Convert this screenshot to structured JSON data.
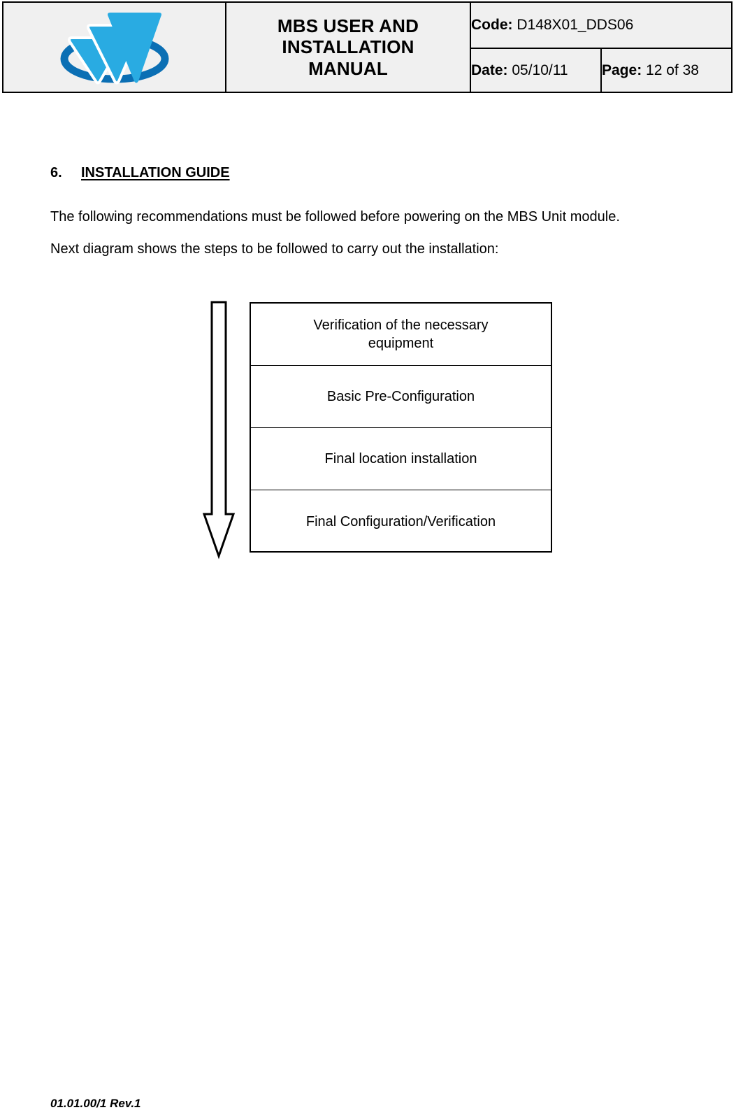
{
  "header": {
    "logo": {
      "name": "company-logo",
      "colors": {
        "arrow_light": "#29ABE2",
        "ring_dark": "#0B6FB4"
      }
    },
    "document_title_lines": [
      "MBS USER AND",
      "INSTALLATION",
      "MANUAL"
    ],
    "code": {
      "label": "Code:",
      "value": "D148X01_DDS06"
    },
    "date": {
      "label": "Date:",
      "value": "05/10/11"
    },
    "page": {
      "label": "Page:",
      "value": "12 of 38"
    }
  },
  "body": {
    "section": {
      "number": "6.",
      "title": "INSTALLATION GUIDE"
    },
    "paragraphs": [
      "The following recommendations must be followed before powering on the MBS Unit module.",
      "Next diagram shows the steps to be followed to carry out the installation:"
    ],
    "diagram": {
      "name": "installation-steps-flow",
      "arrow_direction": "down",
      "steps": [
        "Verification of the necessary equipment",
        "Basic Pre-Configuration",
        "Final location installation",
        "Final Configuration/Verification"
      ],
      "steps_lines": [
        [
          "Verification of the necessary",
          "equipment"
        ],
        [
          "Basic Pre-Configuration"
        ],
        [
          "Final location installation"
        ],
        [
          "Final Configuration/Verification"
        ]
      ]
    }
  },
  "footer": {
    "text": "01.01.00/1 Rev.1"
  }
}
